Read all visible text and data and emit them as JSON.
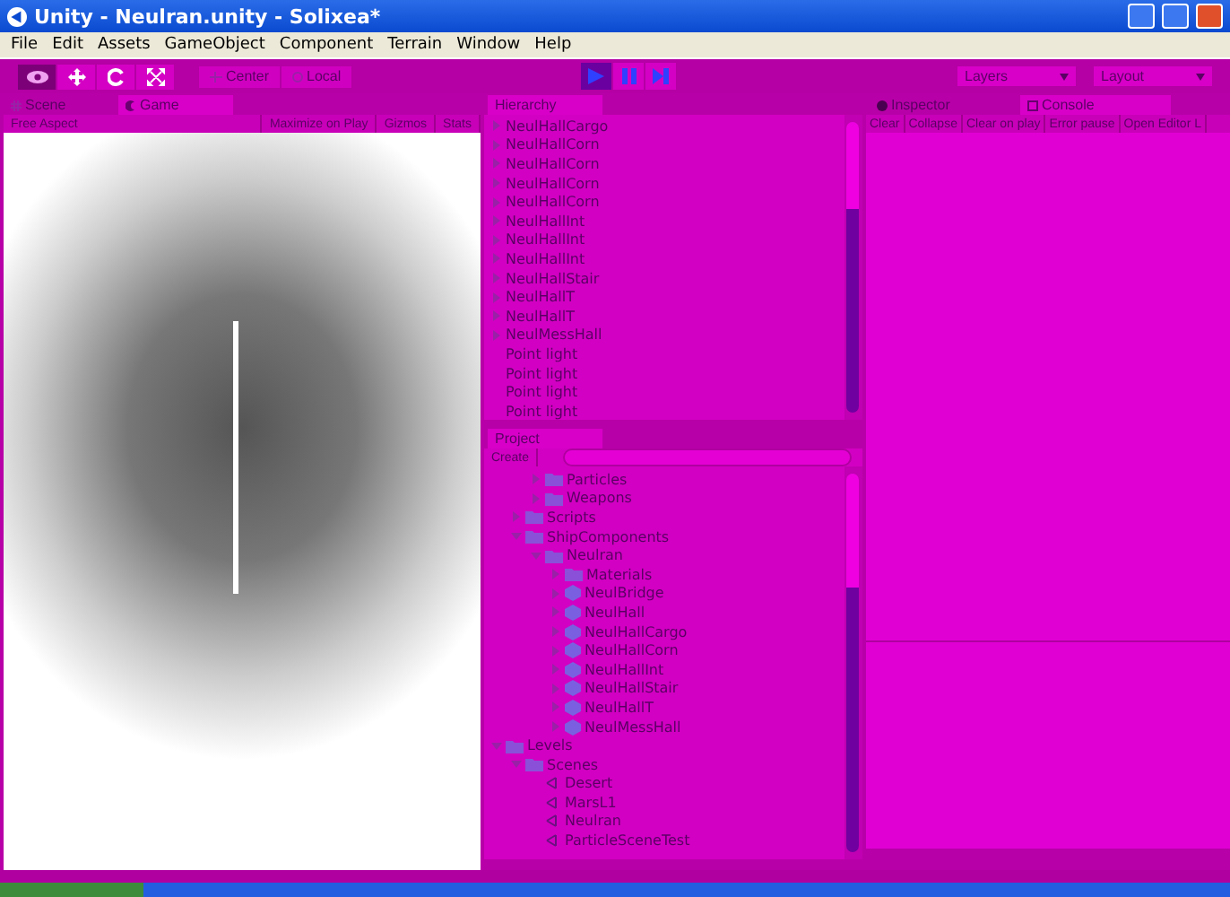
{
  "window": {
    "title": "Unity - Neulran.unity - Solixea*"
  },
  "menu": [
    "File",
    "Edit",
    "Assets",
    "GameObject",
    "Component",
    "Terrain",
    "Window",
    "Help"
  ],
  "toolbar": {
    "tools": [
      {
        "kind": "view",
        "selected": true
      },
      {
        "kind": "move",
        "selected": false
      },
      {
        "kind": "rotate",
        "selected": false
      },
      {
        "kind": "scale",
        "selected": false
      }
    ],
    "pivot": [
      {
        "kind": "pivot",
        "label": "Center"
      },
      {
        "kind": "space",
        "label": "Local"
      }
    ],
    "playback": [
      {
        "kind": "play",
        "selected": true
      },
      {
        "kind": "pause",
        "selected": false
      },
      {
        "kind": "step",
        "selected": false
      }
    ],
    "dropdowns": [
      "Layers",
      "Layout"
    ]
  },
  "view_tabs": [
    {
      "kind": "scene",
      "label": "Scene",
      "selected": false
    },
    {
      "kind": "game",
      "label": "Game",
      "selected": true
    }
  ],
  "game_bar": {
    "aspect": "Free Aspect",
    "buttons": [
      "Maximize on Play",
      "Gizmos",
      "Stats"
    ]
  },
  "hierarchy": {
    "tab": "Hierarchy",
    "items": [
      {
        "label": "NeulHallCargo",
        "expandable": true
      },
      {
        "label": "NeulHallCorn",
        "expandable": true
      },
      {
        "label": "NeulHallCorn",
        "expandable": true
      },
      {
        "label": "NeulHallCorn",
        "expandable": true
      },
      {
        "label": "NeulHallCorn",
        "expandable": true
      },
      {
        "label": "NeulHallInt",
        "expandable": true
      },
      {
        "label": "NeulHallInt",
        "expandable": true
      },
      {
        "label": "NeulHallInt",
        "expandable": true
      },
      {
        "label": "NeulHallStair",
        "expandable": true
      },
      {
        "label": "NeulHallT",
        "expandable": true
      },
      {
        "label": "NeulHallT",
        "expandable": true
      },
      {
        "label": "NeulMessHall",
        "expandable": true
      },
      {
        "label": "Point light",
        "expandable": false
      },
      {
        "label": "Point light",
        "expandable": false
      },
      {
        "label": "Point light",
        "expandable": false
      },
      {
        "label": "Point light",
        "expandable": false
      }
    ]
  },
  "project": {
    "tab": "Project",
    "create": "Create",
    "tree": [
      {
        "children": [
          {
            "children": [
              {
                "label": "Particles",
                "kind": "folder",
                "expanded": false
              },
              {
                "label": "Weapons",
                "kind": "folder",
                "expanded": false
              }
            ]
          },
          {
            "label": "Scripts",
            "kind": "folder",
            "expanded": false
          },
          {
            "label": "ShipComponents",
            "kind": "folder",
            "expanded": true,
            "children": [
              {
                "label": "Neulran",
                "kind": "folder",
                "expanded": true,
                "children": [
                  {
                    "label": "Materials",
                    "kind": "folder",
                    "expanded": false
                  },
                  {
                    "label": "NeulBridge",
                    "kind": "prefab",
                    "expanded": false
                  },
                  {
                    "label": "NeulHall",
                    "kind": "prefab",
                    "expanded": false
                  },
                  {
                    "label": "NeulHallCargo",
                    "kind": "prefab",
                    "expanded": false
                  },
                  {
                    "label": "NeulHallCorn",
                    "kind": "prefab",
                    "expanded": false
                  },
                  {
                    "label": "NeulHallInt",
                    "kind": "prefab",
                    "expanded": false
                  },
                  {
                    "label": "NeulHallStair",
                    "kind": "prefab",
                    "expanded": false
                  },
                  {
                    "label": "NeulHallT",
                    "kind": "prefab",
                    "expanded": false
                  },
                  {
                    "label": "NeulMessHall",
                    "kind": "prefab",
                    "expanded": false
                  }
                ]
              }
            ]
          }
        ]
      },
      {
        "label": "Levels",
        "kind": "folder",
        "expanded": true,
        "children": [
          {
            "label": "Scenes",
            "kind": "folder",
            "expanded": true,
            "children": [
              {
                "label": "Desert",
                "kind": "scene"
              },
              {
                "label": "MarsL1",
                "kind": "scene"
              },
              {
                "label": "Neulran",
                "kind": "scene"
              },
              {
                "label": "ParticleSceneTest",
                "kind": "scene"
              }
            ]
          }
        ]
      }
    ]
  },
  "side_tabs": [
    {
      "kind": "inspector",
      "label": "Inspector",
      "selected": false
    },
    {
      "kind": "console",
      "label": "Console",
      "selected": true
    }
  ],
  "console_bar": [
    "Clear",
    "Collapse",
    "Clear on play",
    "Error pause",
    "Open Editor L"
  ]
}
